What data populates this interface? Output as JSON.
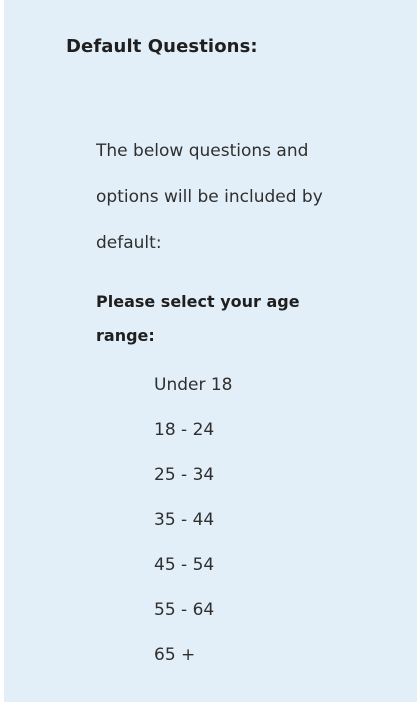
{
  "section": {
    "title": "Default Questions:",
    "intro": "The below questions and options will be included by default:"
  },
  "question": {
    "text": "Please select your age range:",
    "options": [
      "Under 18",
      "18 - 24",
      "25 - 34",
      "35 - 44",
      "45 - 54",
      "55 - 64",
      "65 +"
    ]
  }
}
